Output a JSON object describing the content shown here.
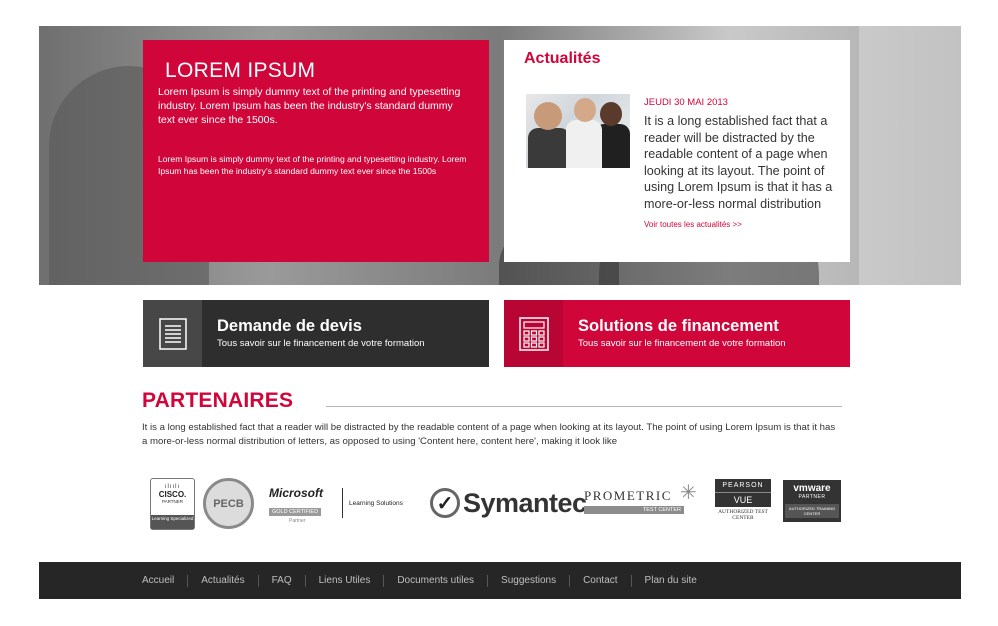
{
  "hero": {
    "title": "LOREM IPSUM",
    "paragraph1": "Lorem Ipsum is simply dummy text of the printing and typesetting industry. Lorem Ipsum has been the industry's standard dummy text ever since the 1500s.",
    "paragraph2": "Lorem Ipsum is simply dummy text of the printing and typesetting industry. Lorem Ipsum has been the industry's standard dummy text ever since the 1500s"
  },
  "news": {
    "title": "Actualités",
    "date": "JEUDI 30 MAI 2013",
    "text": "It is a long established fact that a reader will be distracted by the readable content of a page when looking at its layout. The point of using Lorem Ipsum is that it has a more-or-less normal distribution",
    "link": "Voir toutes les actualités >>"
  },
  "cta": {
    "quote": {
      "title": "Demande de devis",
      "subtitle": "Tous savoir sur le financement de votre formation",
      "icon": "document-icon"
    },
    "financing": {
      "title": "Solutions de financement",
      "subtitle": "Tous savoir sur le financement de votre formation",
      "icon": "calculator-icon"
    }
  },
  "partners": {
    "title": "PARTENAIRES",
    "text": "It is a long established fact that a reader will be distracted by the readable content of a page when looking at its layout. The point of using Lorem Ipsum is that it has a more-or-less normal distribution of letters, as opposed to using 'Content here, content here', making it look like",
    "logos": {
      "cisco": {
        "bars": "ılıılı",
        "name": "CISCO.",
        "partner": "PARTNER",
        "badge": "Learning Specialized"
      },
      "pecb": "PECB",
      "microsoft": {
        "name": "Microsoft",
        "gold": "GOLD CERTIFIED",
        "partner": "Partner",
        "solutions": "Learning Solutions"
      },
      "symantec": {
        "mark": "✓",
        "name": "Symantec."
      },
      "prometric": {
        "name": "PROMETRIC",
        "sub": "TEST CENTER"
      },
      "pearson": {
        "name": "PEARSON",
        "vue": "VUE",
        "sub": "AUTHORIZED TEST CENTER"
      },
      "vmware": {
        "name": "vmware",
        "partner": "PARTNER",
        "sub": "AUTHORIZED TRAINING CENTER"
      }
    }
  },
  "footer": {
    "links": [
      "Accueil",
      "Actualités",
      "FAQ",
      "Liens Utiles",
      "Documents utiles",
      "Suggestions",
      "Contact",
      "Plan du site"
    ]
  },
  "colors": {
    "accent": "#d0063a",
    "dark": "#2e2e2e",
    "footer": "#262626"
  }
}
